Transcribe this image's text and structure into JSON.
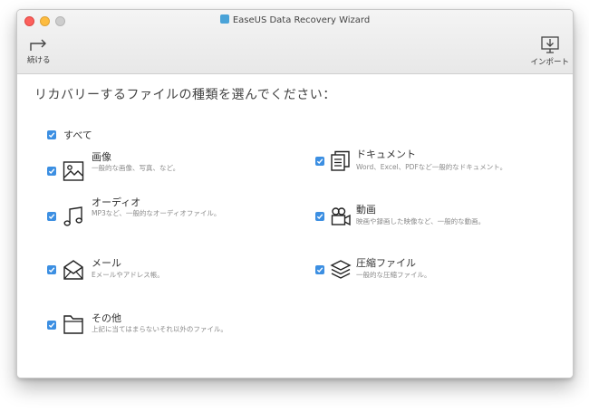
{
  "window": {
    "title": "EaseUS Data Recovery Wizard"
  },
  "toolbar": {
    "continue_label": "続ける",
    "import_label": "インポート"
  },
  "main": {
    "heading": "リカバリーするファイルの種類を選んでください：",
    "select_all": {
      "label": "すべて",
      "checked": true
    },
    "categories": [
      {
        "title": "画像",
        "desc": "一般的な画像、写真、など。",
        "icon": "image-icon",
        "checked": true
      },
      {
        "title": "ドキュメント",
        "desc": "Word、Excel、PDFなど一般的なドキュメント。",
        "icon": "document-icon",
        "checked": true
      },
      {
        "title": "オーディオ",
        "desc": "MP3など、一般的なオーディオファイル。",
        "icon": "music-note-icon",
        "checked": true
      },
      {
        "title": "動画",
        "desc": "映画や録画した映像など、一般的な動画。",
        "icon": "video-camera-icon",
        "checked": true
      },
      {
        "title": "メール",
        "desc": "Eメールやアドレス帳。",
        "icon": "mail-icon",
        "checked": true
      },
      {
        "title": "圧縮ファイル",
        "desc": "一般的な圧縮ファイル。",
        "icon": "layers-icon",
        "checked": true
      },
      {
        "title": "その他",
        "desc": "上記に当てはまらないそれ以外のファイル。",
        "icon": "folder-icon",
        "checked": true
      }
    ]
  },
  "colors": {
    "checkbox": "#3c8fe2",
    "close": "#fc605c",
    "minimize": "#fdbc40"
  }
}
